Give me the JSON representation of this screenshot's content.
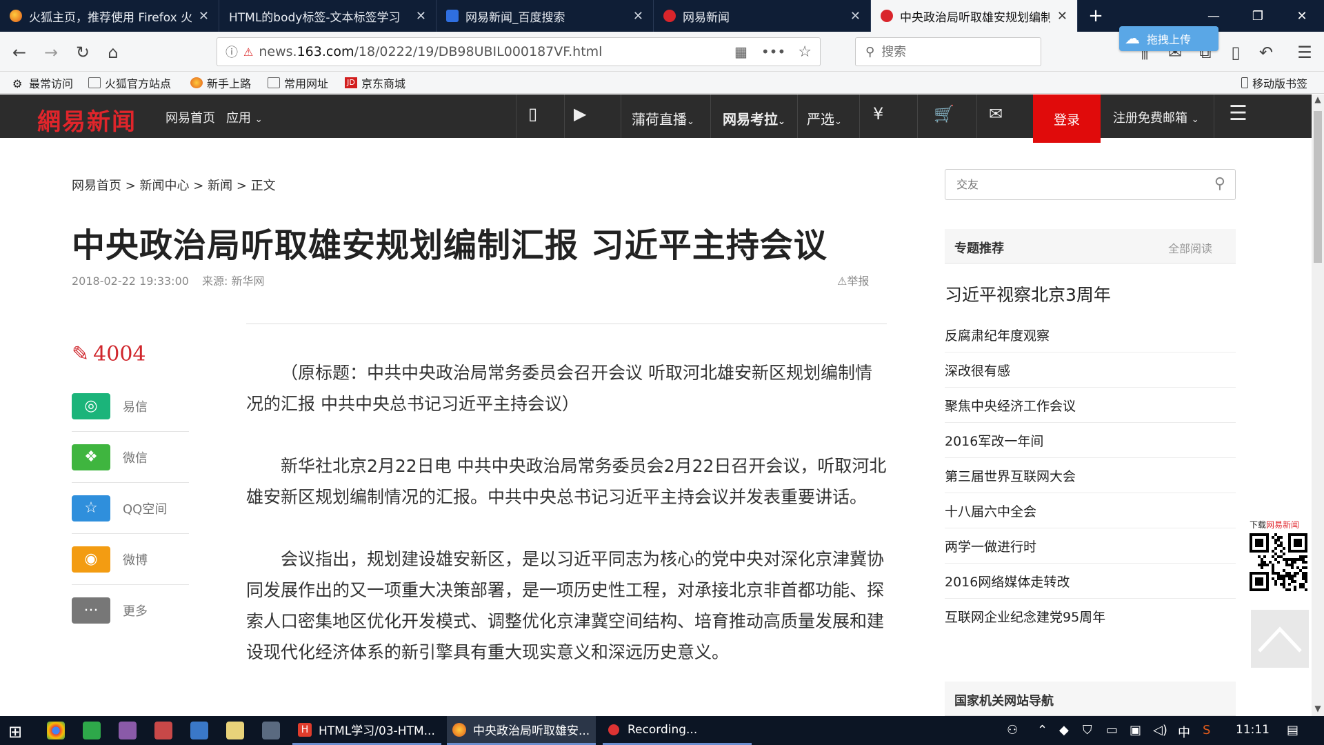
{
  "browser": {
    "tabs": [
      {
        "title": "火狐主页，推荐使用 Firefox 火狐",
        "active": false
      },
      {
        "title": "HTML的body标签-文本标签学习",
        "active": false
      },
      {
        "title": "网易新闻_百度搜索",
        "active": false
      },
      {
        "title": "网易新闻",
        "active": false
      },
      {
        "title": "中央政治局听取雄安规划编制汇报",
        "active": true
      }
    ],
    "url_prefix": "news.",
    "url_domain": "163.com",
    "url_path": "/18/0222/19/DB98UBIL000187VF.html",
    "search_placeholder": "搜索",
    "cloud_upload": "拖拽上传",
    "bookmarks": [
      "最常访问",
      "火狐官方站点",
      "新手上路",
      "常用网址",
      "京东商城"
    ],
    "mobile_bookmarks": "移动版书签"
  },
  "site": {
    "logo": "網易新闻",
    "nav": [
      "网易首页",
      "应用",
      "蒲荷直播",
      "网易考拉",
      "严选"
    ],
    "login": "登录",
    "register": "注册免费邮箱"
  },
  "article": {
    "breadcrumb": [
      "网易首页",
      "新闻中心",
      "新闻",
      "正文"
    ],
    "title": "中央政治局听取雄安规划编制汇报 习近平主持会议",
    "date": "2018-02-22 19:33:00",
    "source": "来源: 新华网",
    "report": "举报",
    "comment_count": "4004",
    "share": [
      {
        "label": "易信",
        "color": "#1bb47a"
      },
      {
        "label": "微信",
        "color": "#3fb53f"
      },
      {
        "label": "QQ空间",
        "color": "#2f8fdc"
      },
      {
        "label": "微博",
        "color": "#f39c12"
      },
      {
        "label": "更多",
        "color": "#777777"
      }
    ],
    "paragraphs": [
      "（原标题：中共中央政治局常务委员会召开会议 听取河北雄安新区规划编制情况的汇报 中共中央总书记习近平主持会议）",
      "新华社北京2月22日电 中共中央政治局常务委员会2月22日召开会议，听取河北雄安新区规划编制情况的汇报。中共中央总书记习近平主持会议并发表重要讲话。",
      "会议指出，规划建设雄安新区，是以习近平同志为核心的党中央对深化京津冀协同发展作出的又一项重大决策部署，是一项历史性工程，对承接北京非首都功能、探索人口密集地区优化开发模式、调整优化京津冀空间结构、培育推动高质量发展和建设现代化经济体系的新引擎具有重大现实意义和深远历史意义。"
    ]
  },
  "sidebar": {
    "search_placeholder": "交友",
    "topics_header": "专题推荐",
    "topics_more": "全部阅读",
    "topic_main": "习近平视察北京3周年",
    "topics": [
      "反腐肃纪年度观察",
      "深改很有感",
      "聚焦中央经济工作会议",
      "2016军改一年间",
      "第三届世界互联网大会",
      "十八届六中全会",
      "两学一做进行时",
      "2016网络媒体走转改",
      "互联网企业纪念建党95周年"
    ],
    "gov_header": "国家机关网站导航",
    "qr_label_prefix": "下载",
    "qr_label_brand": "网易新闻"
  },
  "taskbar": {
    "tasks": [
      {
        "label": "HTML学习/03-HTM...",
        "active": false
      },
      {
        "label": "中央政治局听取雄安...",
        "active": true
      },
      {
        "label": "Recording...",
        "active": false
      }
    ],
    "ime": "中",
    "time": "11:11"
  }
}
